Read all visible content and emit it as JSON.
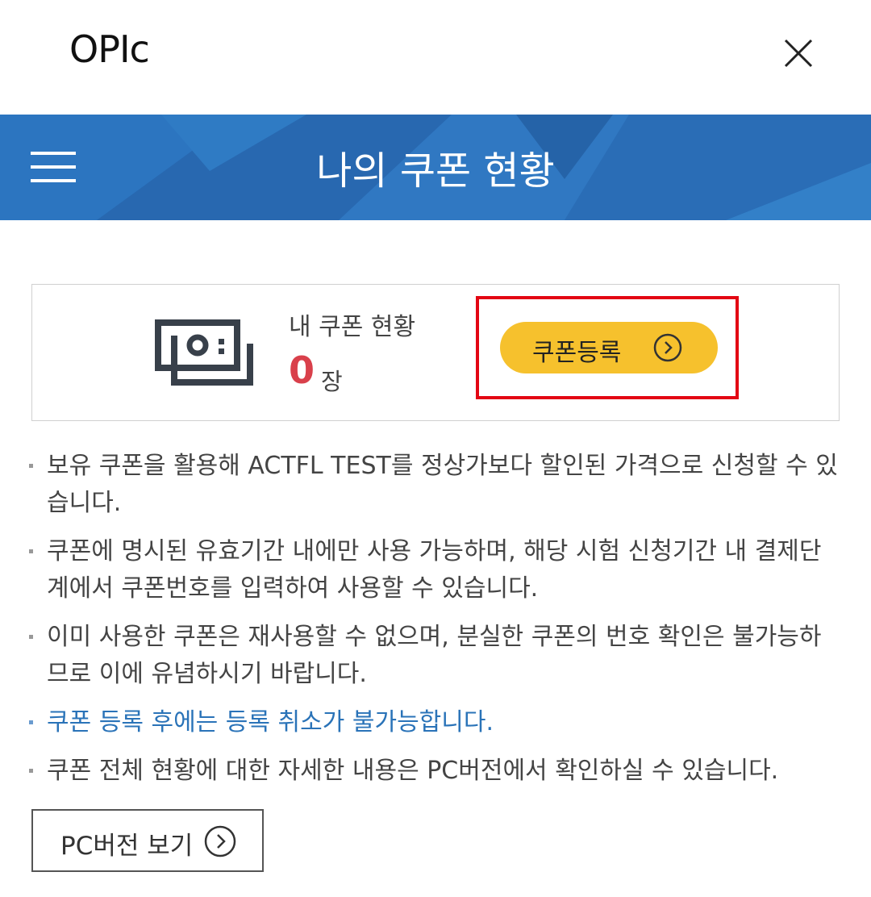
{
  "header": {
    "app_title": "OPIc",
    "close_icon": "close-icon"
  },
  "banner": {
    "title": "나의 쿠폰 현황",
    "menu_icon": "hamburger-menu-icon",
    "color": "#2a6fb9"
  },
  "coupon": {
    "icon": "coupon-cash-icon",
    "label": "내 쿠폰 현황",
    "count": "0",
    "unit": "장",
    "register_label": "쿠폰등록",
    "register_icon": "chevron-right-circle-icon",
    "register_color": "#f6c12d",
    "count_color": "#d9404b",
    "highlight_color": "#e30613"
  },
  "notes": [
    "보유 쿠폰을 활용해 ACTFL TEST를 정상가보다 할인된 가격으로 신청할 수 있습니다.",
    "쿠폰에 명시된 유효기간 내에만 사용 가능하며, 해당 시험 신청기간 내 결제단계에서 쿠폰번호를 입력하여 사용할 수 있습니다.",
    "이미 사용한 쿠폰은 재사용할 수 없으며, 분실한 쿠폰의 번호 확인은 불가능하므로 이에 유념하시기 바랍니다.",
    "쿠폰 등록 후에는 등록 취소가 불가능합니다.",
    "쿠폰 전체 현황에 대한 자세한 내용은 PC버전에서 확인하실 수 있습니다."
  ],
  "pc_button": {
    "label": "PC버전 보기",
    "icon": "chevron-right-circle-icon"
  }
}
